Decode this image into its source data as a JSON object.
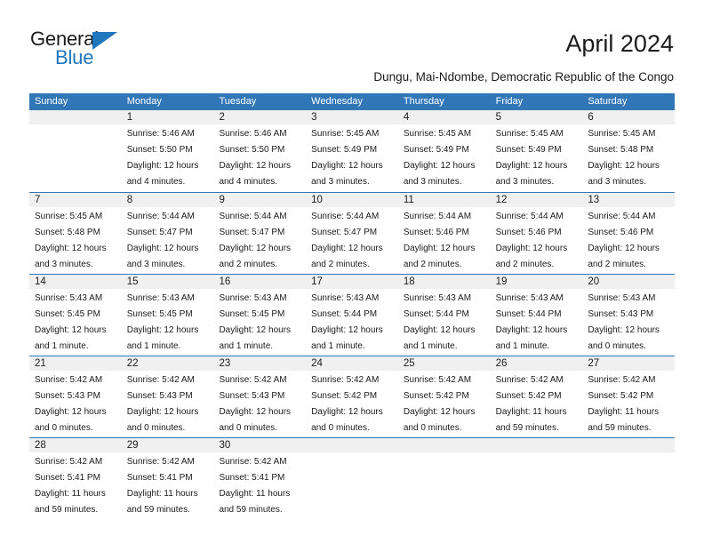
{
  "logo": {
    "text_top": "General",
    "text_bottom": "Blue",
    "triangle_color": "#1f76bc",
    "top_color": "#1b1b1b"
  },
  "header": {
    "month_title": "April 2024",
    "location": "Dungu, Mai-Ndombe, Democratic Republic of the Congo"
  },
  "theme": {
    "header_blue": "#3177b8",
    "row_band_gray": "#f0f0f0",
    "text_color": "#1b1b1b",
    "page_background": "#ffffff"
  },
  "calendar": {
    "weekday_headers": [
      "Sunday",
      "Monday",
      "Tuesday",
      "Wednesday",
      "Thursday",
      "Friday",
      "Saturday"
    ],
    "weeks": [
      [
        {
          "day": "",
          "info": ""
        },
        {
          "day": "1",
          "info": "Sunrise: 5:46 AM\nSunset: 5:50 PM\nDaylight: 12 hours\nand 4 minutes."
        },
        {
          "day": "2",
          "info": "Sunrise: 5:46 AM\nSunset: 5:50 PM\nDaylight: 12 hours\nand 4 minutes."
        },
        {
          "day": "3",
          "info": "Sunrise: 5:45 AM\nSunset: 5:49 PM\nDaylight: 12 hours\nand 3 minutes."
        },
        {
          "day": "4",
          "info": "Sunrise: 5:45 AM\nSunset: 5:49 PM\nDaylight: 12 hours\nand 3 minutes."
        },
        {
          "day": "5",
          "info": "Sunrise: 5:45 AM\nSunset: 5:49 PM\nDaylight: 12 hours\nand 3 minutes."
        },
        {
          "day": "6",
          "info": "Sunrise: 5:45 AM\nSunset: 5:48 PM\nDaylight: 12 hours\nand 3 minutes."
        }
      ],
      [
        {
          "day": "7",
          "info": "Sunrise: 5:45 AM\nSunset: 5:48 PM\nDaylight: 12 hours\nand 3 minutes."
        },
        {
          "day": "8",
          "info": "Sunrise: 5:44 AM\nSunset: 5:47 PM\nDaylight: 12 hours\nand 3 minutes."
        },
        {
          "day": "9",
          "info": "Sunrise: 5:44 AM\nSunset: 5:47 PM\nDaylight: 12 hours\nand 2 minutes."
        },
        {
          "day": "10",
          "info": "Sunrise: 5:44 AM\nSunset: 5:47 PM\nDaylight: 12 hours\nand 2 minutes."
        },
        {
          "day": "11",
          "info": "Sunrise: 5:44 AM\nSunset: 5:46 PM\nDaylight: 12 hours\nand 2 minutes."
        },
        {
          "day": "12",
          "info": "Sunrise: 5:44 AM\nSunset: 5:46 PM\nDaylight: 12 hours\nand 2 minutes."
        },
        {
          "day": "13",
          "info": "Sunrise: 5:44 AM\nSunset: 5:46 PM\nDaylight: 12 hours\nand 2 minutes."
        }
      ],
      [
        {
          "day": "14",
          "info": "Sunrise: 5:43 AM\nSunset: 5:45 PM\nDaylight: 12 hours\nand 1 minute."
        },
        {
          "day": "15",
          "info": "Sunrise: 5:43 AM\nSunset: 5:45 PM\nDaylight: 12 hours\nand 1 minute."
        },
        {
          "day": "16",
          "info": "Sunrise: 5:43 AM\nSunset: 5:45 PM\nDaylight: 12 hours\nand 1 minute."
        },
        {
          "day": "17",
          "info": "Sunrise: 5:43 AM\nSunset: 5:44 PM\nDaylight: 12 hours\nand 1 minute."
        },
        {
          "day": "18",
          "info": "Sunrise: 5:43 AM\nSunset: 5:44 PM\nDaylight: 12 hours\nand 1 minute."
        },
        {
          "day": "19",
          "info": "Sunrise: 5:43 AM\nSunset: 5:44 PM\nDaylight: 12 hours\nand 1 minute."
        },
        {
          "day": "20",
          "info": "Sunrise: 5:43 AM\nSunset: 5:43 PM\nDaylight: 12 hours\nand 0 minutes."
        }
      ],
      [
        {
          "day": "21",
          "info": "Sunrise: 5:42 AM\nSunset: 5:43 PM\nDaylight: 12 hours\nand 0 minutes."
        },
        {
          "day": "22",
          "info": "Sunrise: 5:42 AM\nSunset: 5:43 PM\nDaylight: 12 hours\nand 0 minutes."
        },
        {
          "day": "23",
          "info": "Sunrise: 5:42 AM\nSunset: 5:43 PM\nDaylight: 12 hours\nand 0 minutes."
        },
        {
          "day": "24",
          "info": "Sunrise: 5:42 AM\nSunset: 5:42 PM\nDaylight: 12 hours\nand 0 minutes."
        },
        {
          "day": "25",
          "info": "Sunrise: 5:42 AM\nSunset: 5:42 PM\nDaylight: 12 hours\nand 0 minutes."
        },
        {
          "day": "26",
          "info": "Sunrise: 5:42 AM\nSunset: 5:42 PM\nDaylight: 11 hours\nand 59 minutes."
        },
        {
          "day": "27",
          "info": "Sunrise: 5:42 AM\nSunset: 5:42 PM\nDaylight: 11 hours\nand 59 minutes."
        }
      ],
      [
        {
          "day": "28",
          "info": "Sunrise: 5:42 AM\nSunset: 5:41 PM\nDaylight: 11 hours\nand 59 minutes."
        },
        {
          "day": "29",
          "info": "Sunrise: 5:42 AM\nSunset: 5:41 PM\nDaylight: 11 hours\nand 59 minutes."
        },
        {
          "day": "30",
          "info": "Sunrise: 5:42 AM\nSunset: 5:41 PM\nDaylight: 11 hours\nand 59 minutes."
        },
        {
          "day": "",
          "info": ""
        },
        {
          "day": "",
          "info": ""
        },
        {
          "day": "",
          "info": ""
        },
        {
          "day": "",
          "info": ""
        }
      ]
    ]
  }
}
